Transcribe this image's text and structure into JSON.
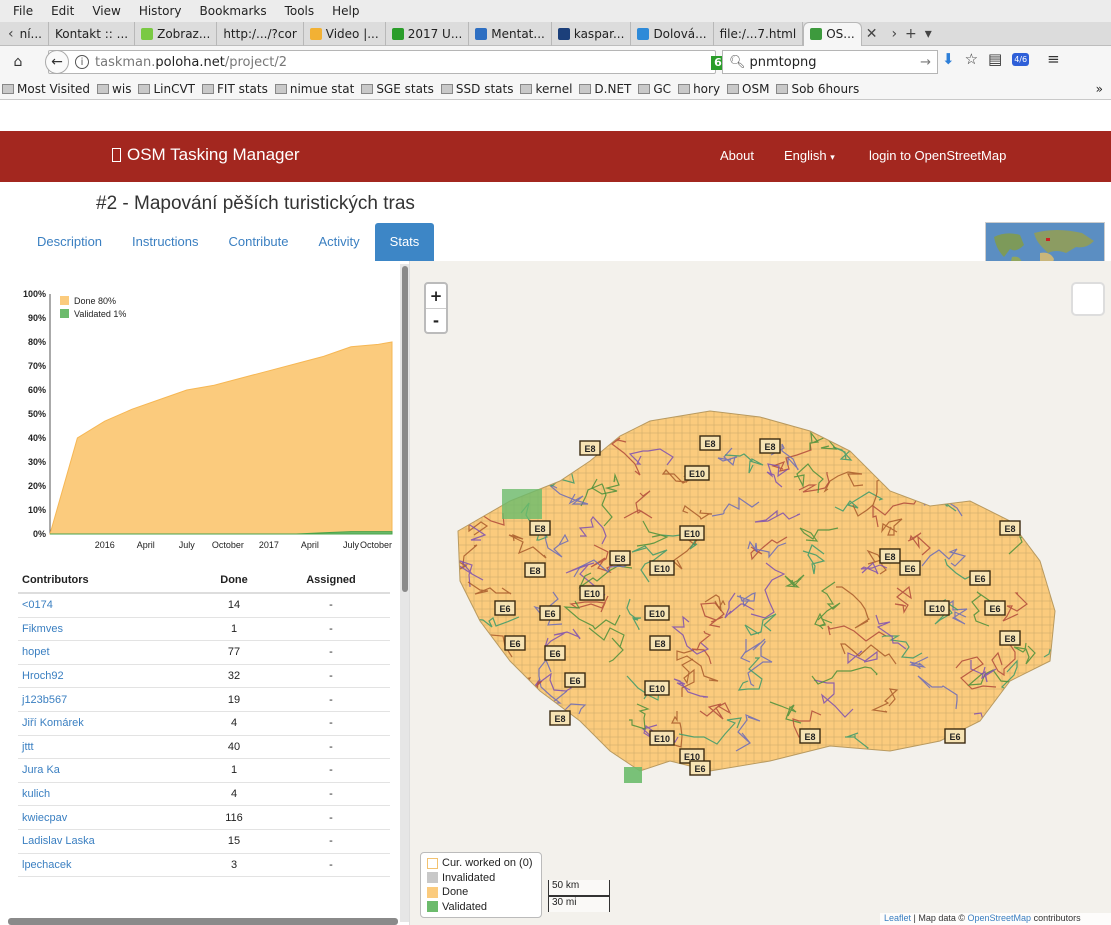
{
  "menubar": [
    "File",
    "Edit",
    "View",
    "History",
    "Bookmarks",
    "Tools",
    "Help"
  ],
  "tabs": [
    {
      "label": "ní...",
      "color": ""
    },
    {
      "label": "Kontakt :: ...",
      "color": ""
    },
    {
      "label": "Zobraz...",
      "color": "#7ac943"
    },
    {
      "label": "http:/.../?cor",
      "color": ""
    },
    {
      "label": "Video |...",
      "color": "#f2b134"
    },
    {
      "label": "2017 U...",
      "color": "#2a9d2a"
    },
    {
      "label": "Mentat...",
      "color": "#2e6fc2"
    },
    {
      "label": "kaspar...",
      "color": "#1b3f7a"
    },
    {
      "label": "Dolová...",
      "color": "#2e8ad8"
    },
    {
      "label": "file:/...7.html",
      "color": ""
    },
    {
      "label": "OS...",
      "color": "#3d9a3d"
    }
  ],
  "url": {
    "host": "taskman.",
    "domain": "poloha.net",
    "path": "/project/2",
    "badge": "6"
  },
  "search": {
    "value": "pnmtopng"
  },
  "addon_badge": "4/6",
  "bookmarks": [
    "Most Visited",
    "wis",
    "LinCVT",
    "FIT stats",
    "nimue stat",
    "SGE stats",
    "SSD stats",
    "kernel",
    "D.NET",
    "GC",
    "hory",
    "OSM",
    "Sob 6hours"
  ],
  "header": {
    "brand": "OSM Tasking Manager",
    "about": "About",
    "language": "English",
    "login": "login to OpenStreetMap"
  },
  "project": {
    "title": "#2 - Mapování pěších turistických tras"
  },
  "subtabs": [
    "Description",
    "Instructions",
    "Contribute",
    "Activity",
    "Stats"
  ],
  "chart_data": {
    "type": "area",
    "x": [
      "2015-09",
      "2015-11",
      "2016-01",
      "2016-03",
      "2016-05",
      "2016-07",
      "2016-09",
      "2016-11",
      "2017-01",
      "2017-03",
      "2017-05",
      "2017-07",
      "2017-09",
      "2017-10"
    ],
    "series": [
      {
        "name": "Done 80%",
        "color": "#fbcb7d",
        "values": [
          0,
          40,
          47,
          52,
          56,
          60,
          62,
          65,
          68,
          71,
          74,
          78,
          79,
          80
        ]
      },
      {
        "name": "Validated 1%",
        "color": "#6cbb6c",
        "values": [
          0,
          0,
          0,
          0,
          0,
          0,
          0,
          0,
          0,
          0,
          0.5,
          1,
          1,
          1
        ]
      }
    ],
    "xticks": [
      "2016",
      "April",
      "July",
      "October",
      "2017",
      "April",
      "July",
      "October"
    ],
    "yticks": [
      "0%",
      "10%",
      "20%",
      "30%",
      "40%",
      "50%",
      "60%",
      "70%",
      "80%",
      "90%",
      "100%"
    ],
    "ylim": [
      0,
      100
    ],
    "legend": "top-left"
  },
  "contributors": {
    "headers": [
      "Contributors",
      "Done",
      "Assigned"
    ],
    "rows": [
      {
        "name": "<0174",
        "done": "14",
        "assigned": "-"
      },
      {
        "name": "Fikmves",
        "done": "1",
        "assigned": "-"
      },
      {
        "name": "hopet",
        "done": "77",
        "assigned": "-"
      },
      {
        "name": "Hroch92",
        "done": "32",
        "assigned": "-"
      },
      {
        "name": "j123b567",
        "done": "19",
        "assigned": "-"
      },
      {
        "name": "Jiří Komárek",
        "done": "4",
        "assigned": "-"
      },
      {
        "name": "jttt",
        "done": "40",
        "assigned": "-"
      },
      {
        "name": "Jura Ka",
        "done": "1",
        "assigned": "-"
      },
      {
        "name": "kulich",
        "done": "4",
        "assigned": "-"
      },
      {
        "name": "kwiecpav",
        "done": "116",
        "assigned": "-"
      },
      {
        "name": "Ladislav Laska",
        "done": "15",
        "assigned": "-"
      },
      {
        "name": "lpechacek",
        "done": "3",
        "assigned": "-"
      }
    ]
  },
  "map": {
    "zoom_in": "+",
    "zoom_out": "-",
    "legend": [
      {
        "label": "Cur. worked on (0)",
        "color": "#ffffff",
        "border": "#f2c270"
      },
      {
        "label": "Invalidated",
        "color": "#c8c8c8",
        "border": "#c8c8c8"
      },
      {
        "label": "Done",
        "color": "#fbcb7d",
        "border": "#fbcb7d"
      },
      {
        "label": "Validated",
        "color": "#6cbb6c",
        "border": "#6cbb6c"
      }
    ],
    "scale_km": "50 km",
    "scale_mi": "30 mi",
    "attribution": {
      "leaflet": "Leaflet",
      "sep": " | Map data © ",
      "osm": "OpenStreetMap",
      "tail": " contributors"
    },
    "labels": [
      "E8",
      "E8",
      "E8",
      "E10",
      "E8",
      "E10",
      "E8",
      "E8",
      "E8",
      "E10",
      "E6",
      "E6",
      "E10",
      "E6",
      "E6",
      "E6",
      "E10",
      "E6",
      "E6",
      "E10",
      "E10",
      "E8",
      "E6",
      "E6",
      "E10",
      "E8",
      "E8",
      "E8",
      "E8",
      "E10",
      "E6"
    ]
  }
}
